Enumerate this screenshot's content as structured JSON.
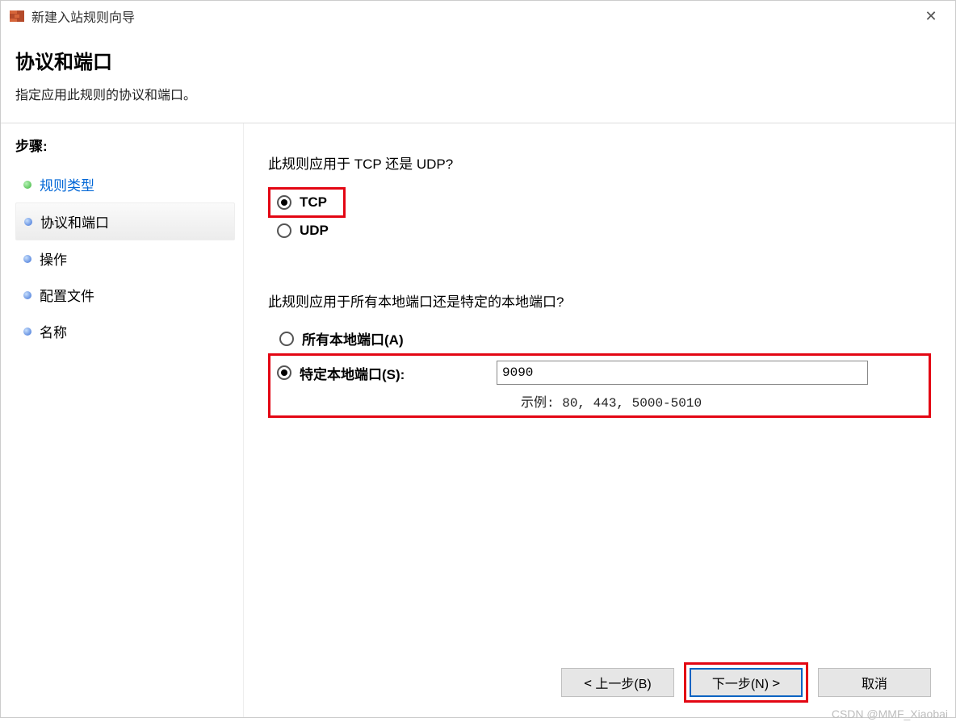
{
  "window": {
    "title": "新建入站规则向导",
    "close_glyph": "✕"
  },
  "header": {
    "heading": "协议和端口",
    "subheading": "指定应用此规则的协议和端口。"
  },
  "sidebar": {
    "title": "步骤:",
    "steps": [
      {
        "label": "规则类型",
        "bullet": "green",
        "active": true,
        "current": false
      },
      {
        "label": "协议和端口",
        "bullet": "blue",
        "active": false,
        "current": true
      },
      {
        "label": "操作",
        "bullet": "blue",
        "active": false,
        "current": false
      },
      {
        "label": "配置文件",
        "bullet": "blue",
        "active": false,
        "current": false
      },
      {
        "label": "名称",
        "bullet": "blue",
        "active": false,
        "current": false
      }
    ]
  },
  "main": {
    "protocol_question": "此规则应用于 TCP 还是 UDP?",
    "protocol_options": {
      "tcp": {
        "label": "TCP",
        "checked": true
      },
      "udp": {
        "label": "UDP",
        "checked": false
      }
    },
    "port_question": "此规则应用于所有本地端口还是特定的本地端口?",
    "port_options": {
      "all": {
        "label": "所有本地端口(A)",
        "checked": false
      },
      "specific": {
        "label": "特定本地端口(S):",
        "checked": true,
        "value": "9090"
      }
    },
    "port_example_prefix": "示例: ",
    "port_example_value": "80, 443, 5000-5010"
  },
  "footer": {
    "back": "上一步(B)",
    "next": "下一步(N)",
    "cancel": "取消",
    "chev_left": "<",
    "chev_right": ">"
  },
  "watermark": "CSDN @MMF_Xiaobai"
}
